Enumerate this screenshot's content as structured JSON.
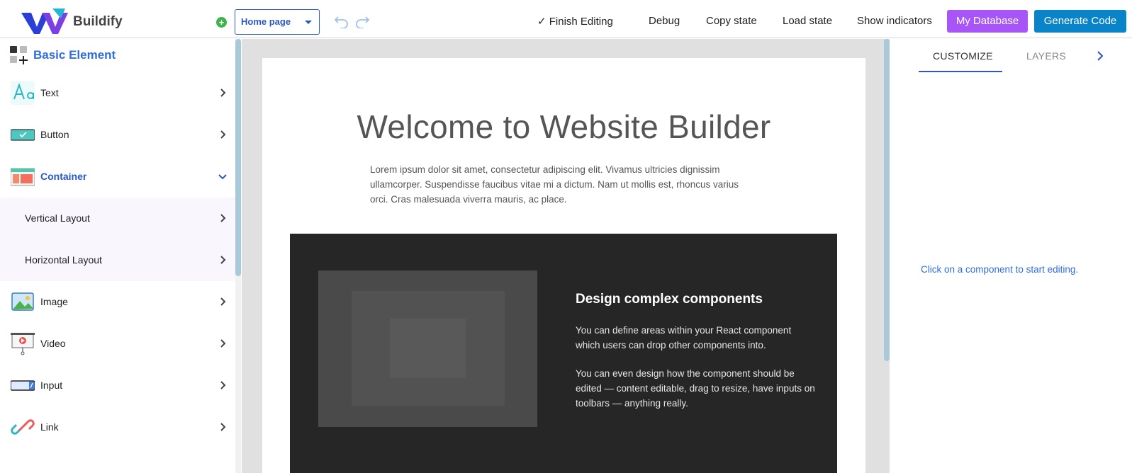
{
  "app": {
    "brand": "Buildify"
  },
  "toolbar": {
    "page_select": "Home page",
    "finish_editing": "Finish Editing",
    "debug": "Debug",
    "copy_state": "Copy state",
    "load_state": "Load state",
    "show_indicators": "Show indicators",
    "my_database": "My Database",
    "generate_code": "Generate Code"
  },
  "sidebar": {
    "header": "Basic Element",
    "items": [
      {
        "label": "Text",
        "icon": "text-icon"
      },
      {
        "label": "Button",
        "icon": "button-icon"
      },
      {
        "label": "Container",
        "icon": "container-icon",
        "expanded": true
      },
      {
        "label": "Vertical Layout",
        "sub": true
      },
      {
        "label": "Horizontal Layout",
        "sub": true
      },
      {
        "label": "Image",
        "icon": "image-icon"
      },
      {
        "label": "Video",
        "icon": "video-icon"
      },
      {
        "label": "Input",
        "icon": "input-icon"
      },
      {
        "label": "Link",
        "icon": "link-icon"
      }
    ]
  },
  "canvas": {
    "hero_title": "Welcome to Website Builder",
    "hero_text": "Lorem ipsum dolor sit amet, consectetur adipiscing elit. Vivamus ultricies dignissim ullamcorper. Suspendisse faucibus vitae mi a dictum. Nam ut mollis est, rhoncus varius orci. Cras malesuada viverra mauris, ac place.",
    "feature": {
      "title": "Design complex components",
      "p1": "You can define areas within your React component which users can drop other components into.",
      "p2": "You can even design how the component should be edited — content editable, drag to resize, have inputs on toolbars — anything really."
    }
  },
  "right_panel": {
    "tabs": [
      "CUSTOMIZE",
      "LAYERS"
    ],
    "hint": "Click on a component to start editing."
  },
  "colors": {
    "accent": "#2a56c6",
    "database_button": "#a855f7",
    "generate_button": "#0a84c8",
    "feature_bg": "#262626"
  }
}
